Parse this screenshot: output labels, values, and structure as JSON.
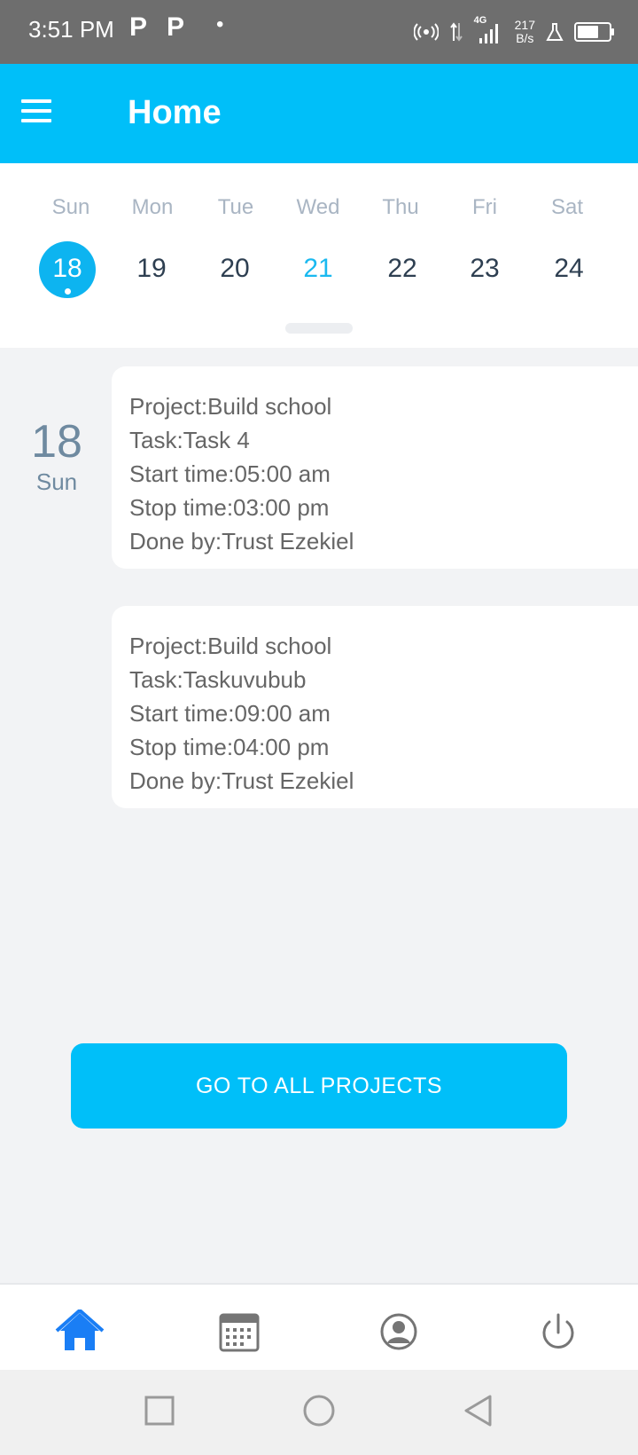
{
  "status_bar": {
    "time": "3:51 PM",
    "notification_glyphs": [
      "P",
      "P"
    ],
    "dot": "•",
    "network": "4G",
    "speed_value": "217",
    "speed_unit": "B/s"
  },
  "app_bar": {
    "title": "Home",
    "menu_icon": "hamburger-menu-icon"
  },
  "calendar": {
    "days": [
      {
        "name": "Sun",
        "number": "18",
        "selected": true
      },
      {
        "name": "Mon",
        "number": "19"
      },
      {
        "name": "Tue",
        "number": "20"
      },
      {
        "name": "Wed",
        "number": "21",
        "accent": true
      },
      {
        "name": "Thu",
        "number": "22"
      },
      {
        "name": "Fri",
        "number": "23"
      },
      {
        "name": "Sat",
        "number": "24"
      }
    ],
    "selected_date": {
      "number": "18",
      "day": "Sun"
    }
  },
  "tasks": [
    {
      "project": "Project:Build school",
      "task": "Task:Task 4",
      "start": "Start time:05:00 am",
      "stop": "Stop time:03:00 pm",
      "done_by": "Done by:Trust Ezekiel"
    },
    {
      "project": "Project:Build school",
      "task": "Task:Taskuvubub",
      "start": "Start time:09:00 am",
      "stop": "Stop time:04:00 pm",
      "done_by": "Done by:Trust Ezekiel"
    }
  ],
  "actions": {
    "all_projects_label": "GO TO ALL PROJECTS"
  },
  "bottom_nav": {
    "items": [
      "home-icon",
      "calendar-icon",
      "profile-icon",
      "power-icon"
    ],
    "active": "home-icon",
    "active_color": "#1a7ef5",
    "inactive_color": "#757575"
  },
  "colors": {
    "primary": "#00bff9",
    "selected_day": "#0db4f0",
    "accent_day": "#1ab9f0"
  }
}
